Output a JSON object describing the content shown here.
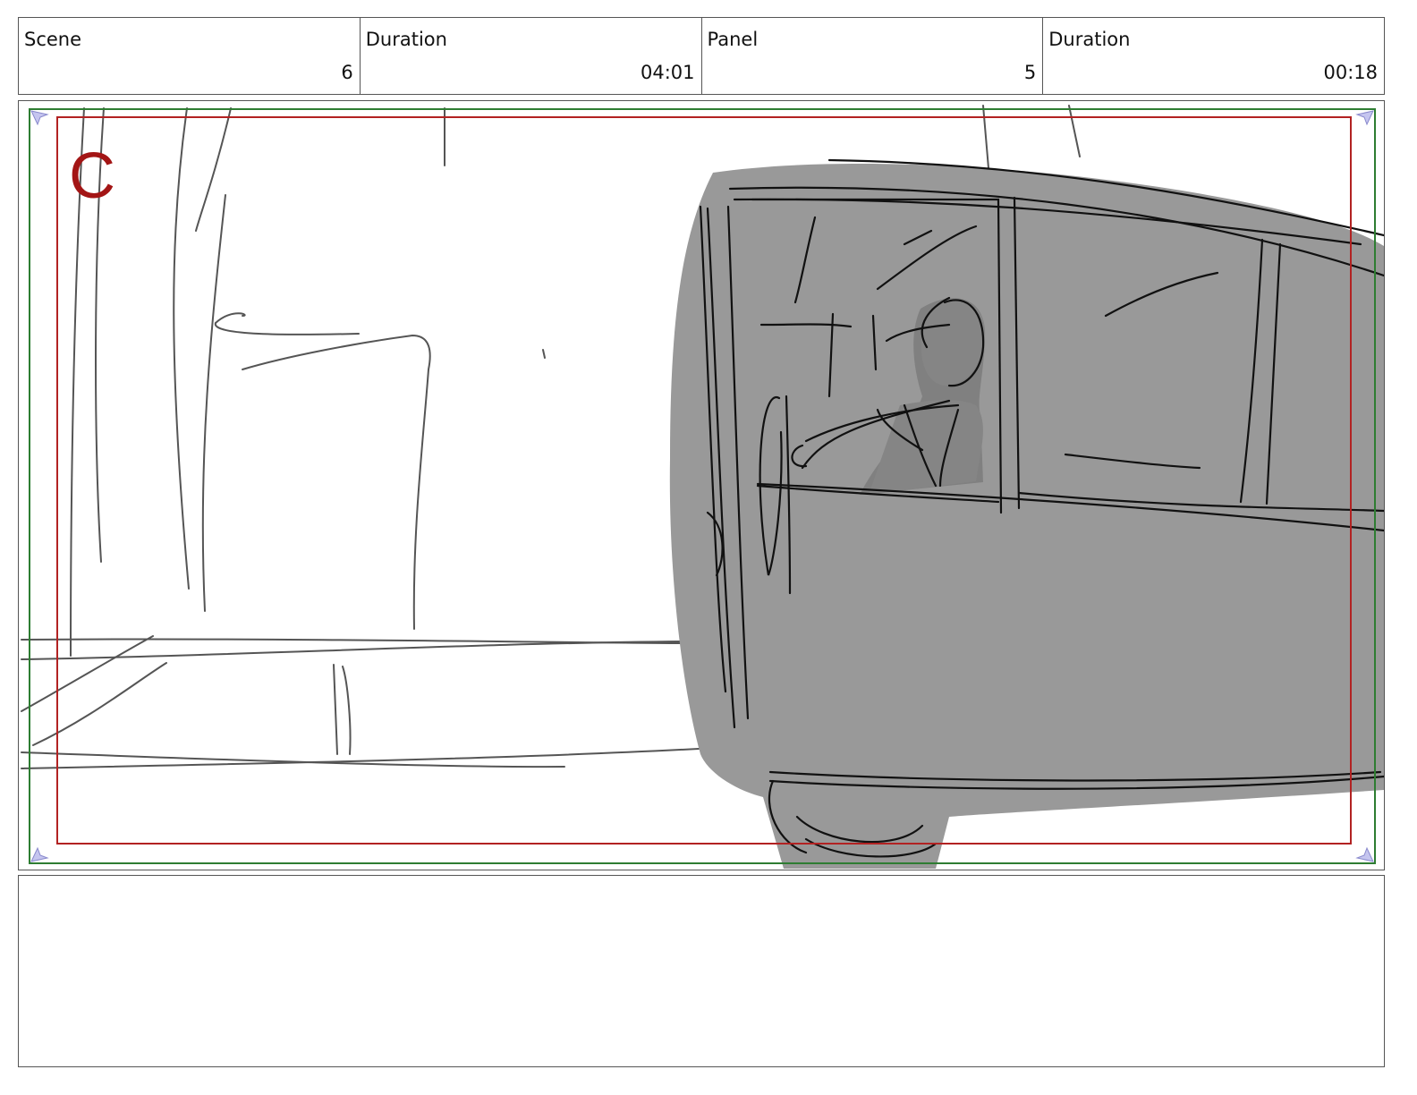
{
  "header": {
    "scene": {
      "label": "Scene",
      "value": "6"
    },
    "scene_duration": {
      "label": "Duration",
      "value": "04:01"
    },
    "panel": {
      "label": "Panel",
      "value": "5"
    },
    "panel_duration": {
      "label": "Duration",
      "value": "00:18"
    }
  },
  "frame": {
    "camera_label": "C",
    "colors": {
      "outer_safe_frame": "#2e7d32",
      "inner_camera_frame": "#b22222",
      "vehicle_fill": "#999999",
      "figure_fill": "#808080",
      "sketch_line": "#555555",
      "ink_line": "#111111"
    },
    "icons": [
      "corner-marker-icon"
    ]
  },
  "notes": {
    "text": ""
  }
}
